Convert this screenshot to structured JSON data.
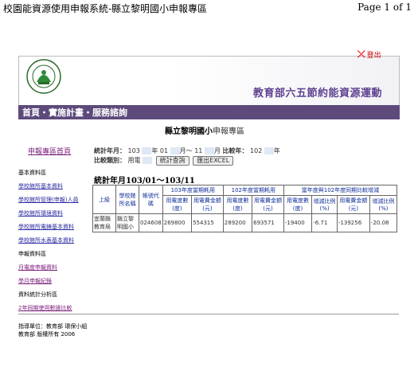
{
  "print_header": {
    "title": "校園能資源使用申報系統-縣立黎明國小申報專區",
    "page": "Page 1 of 1"
  },
  "logout_label": "登出",
  "header": {
    "logo_text": "MINISTRY OF EDUCATION",
    "title": "教育部六五節約能資源運動"
  },
  "nav": {
    "items": [
      "首頁",
      "實施計畫",
      "服務諮詢"
    ],
    "separator": "・"
  },
  "school": {
    "name": "縣立黎明國小",
    "suffix": "申報專區"
  },
  "sidebar": {
    "home": "申報專區首頁",
    "sections": [
      {
        "title": "基本資料區",
        "links": [
          "學校館所基本資料",
          "學校館所管理(申報)人員",
          "學校館所環境資料",
          "學校館所電錶基本資料",
          "學校館所水表基本資料"
        ]
      },
      {
        "title": "申報資料區",
        "links": [
          "月電度申報資料",
          "學月申報紀錄"
        ]
      },
      {
        "title": "資料統計分析區",
        "links": [
          "2年同期使用數據比較"
        ]
      }
    ]
  },
  "filters": {
    "stats_label": "統計年月：",
    "year_from": "103",
    "year_unit": "年",
    "month_from": "01",
    "month_unit": "月～",
    "month_to": "11",
    "month_to_unit": "月",
    "compare_label": "比較年：",
    "compare_year": "102",
    "compare_unit": "年",
    "category_label": "比較類別：",
    "category_value": "用電",
    "query_button": "統計查詢",
    "excel_button": "匯出EXCEL"
  },
  "period_title": "統計年月103/01～103/11",
  "table": {
    "h_level": "上級",
    "h_school": "學校館所名稱",
    "h_code": "帳號代碼",
    "h_group1": "103年度當期耗用",
    "h_group2": "102年度當期耗用",
    "h_group3": "當年度與102年度同期比較增減",
    "sub": [
      "用電度數(度)",
      "用電費金額(元)",
      "用電度數(度)",
      "用電費金額(元)",
      "用電度數(度)",
      "增減比例(%)",
      "用電費金額(元)",
      "增減比例(%)"
    ],
    "rows": [
      {
        "level": "宜蘭縣教育局",
        "school": "縣立黎明國小",
        "code": "024608",
        "values": [
          "269800",
          "554315",
          "289200",
          "693571",
          "-19400",
          "-6.71",
          "-139256",
          "-20.08"
        ]
      }
    ]
  },
  "footer": {
    "line1": "指導單位：教育部 環保小組",
    "line2": "教育部 版權所有 2006"
  }
}
